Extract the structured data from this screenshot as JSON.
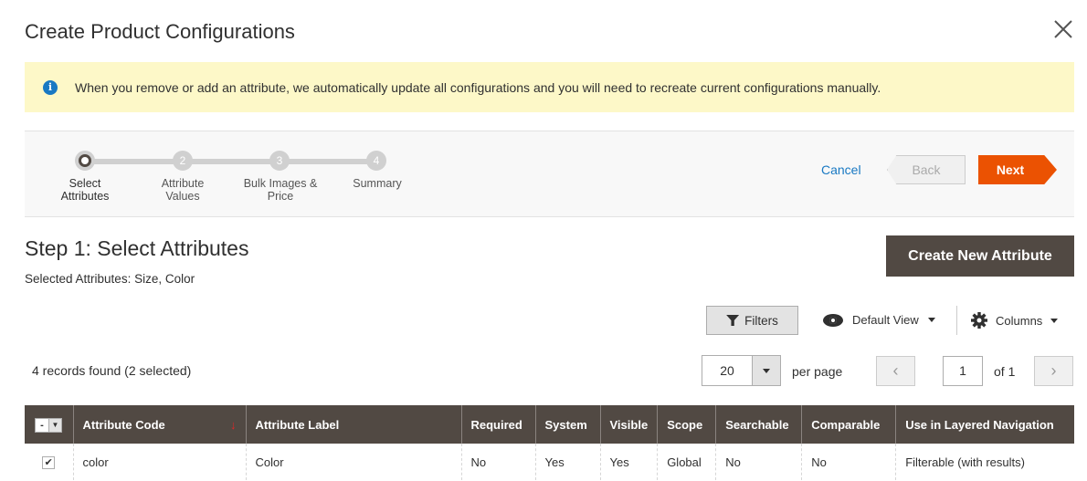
{
  "modal": {
    "title": "Create Product Configurations",
    "close": "×"
  },
  "notice": {
    "icon": "info-icon",
    "text": "When you remove or add an attribute, we automatically update all configurations and you will need to recreate current configurations manually."
  },
  "steps": [
    {
      "num": "",
      "label": "Select Attributes",
      "active": true
    },
    {
      "num": "2",
      "label": "Attribute Values"
    },
    {
      "num": "3",
      "label": "Bulk Images & Price"
    },
    {
      "num": "4",
      "label": "Summary"
    }
  ],
  "nav": {
    "cancel": "Cancel",
    "back": "Back",
    "next": "Next"
  },
  "colors": {
    "accent": "#eb5202",
    "header": "#514943",
    "link": "#1979c3",
    "notice": "#fdf8c8"
  },
  "page": {
    "heading": "Step 1: Select Attributes",
    "selected": "Selected Attributes: Size, Color",
    "create": "Create New Attribute"
  },
  "toolbar": {
    "filters": "Filters",
    "view": "Default View",
    "columns": "Columns",
    "records": "4 records found (2 selected)",
    "per_page_value": "20",
    "per_page": "per page",
    "page": "1",
    "of": "of 1"
  },
  "table": {
    "mass": "-",
    "sort_icon": "↓",
    "headers": [
      "Attribute Code",
      "Attribute Label",
      "Required",
      "System",
      "Visible",
      "Scope",
      "Searchable",
      "Comparable",
      "Use in Layered Navigation"
    ],
    "rows": [
      {
        "checked": true,
        "cells": [
          "color",
          "Color",
          "No",
          "Yes",
          "Yes",
          "Global",
          "No",
          "No",
          "Filterable (with results)"
        ]
      }
    ]
  }
}
